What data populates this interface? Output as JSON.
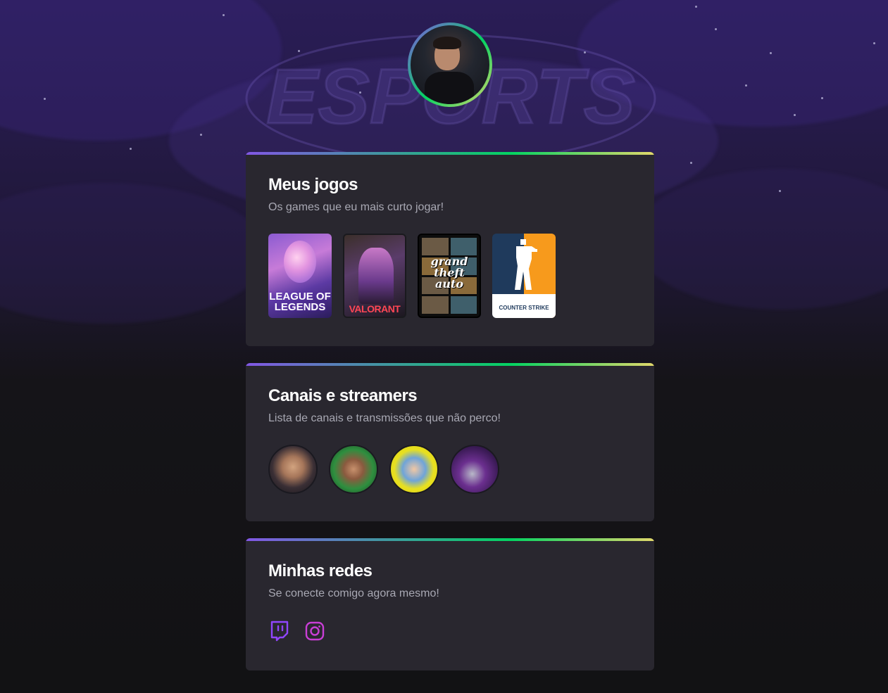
{
  "background": {
    "watermark_text": "ESPORTS"
  },
  "profile": {
    "avatar_icon": "profile-photo"
  },
  "games_section": {
    "title": "Meus jogos",
    "subtitle": "Os games que eu mais curto jogar!",
    "games": [
      {
        "name": "LEAGUE OF LEGENDS",
        "label": "LEAGUE OF LEGENDS"
      },
      {
        "name": "VALORANT",
        "label": "VALORANT"
      },
      {
        "name": "Grand Theft Auto V",
        "label": "grand theft auto"
      },
      {
        "name": "Counter-Strike",
        "label": "COUNTER STRIKE"
      }
    ]
  },
  "channels_section": {
    "title": "Canais e streamers",
    "subtitle": "Lista de canais e transmissões que não perco!",
    "channels": [
      {
        "icon": "streamer-avatar"
      },
      {
        "icon": "streamer-avatar"
      },
      {
        "icon": "streamer-avatar"
      },
      {
        "icon": "streamer-avatar"
      }
    ]
  },
  "social_section": {
    "title": "Minhas redes",
    "subtitle": "Se conecte comigo agora mesmo!",
    "links": [
      {
        "icon": "twitch-icon",
        "color": "#9146ff"
      },
      {
        "icon": "instagram-icon",
        "color": "#c93ed6"
      }
    ]
  },
  "colors": {
    "gradient_start": "#8257e5",
    "gradient_mid": "#04d361",
    "gradient_end": "#e1d86b",
    "card_bg": "#29272f",
    "page_bg": "#121214"
  }
}
